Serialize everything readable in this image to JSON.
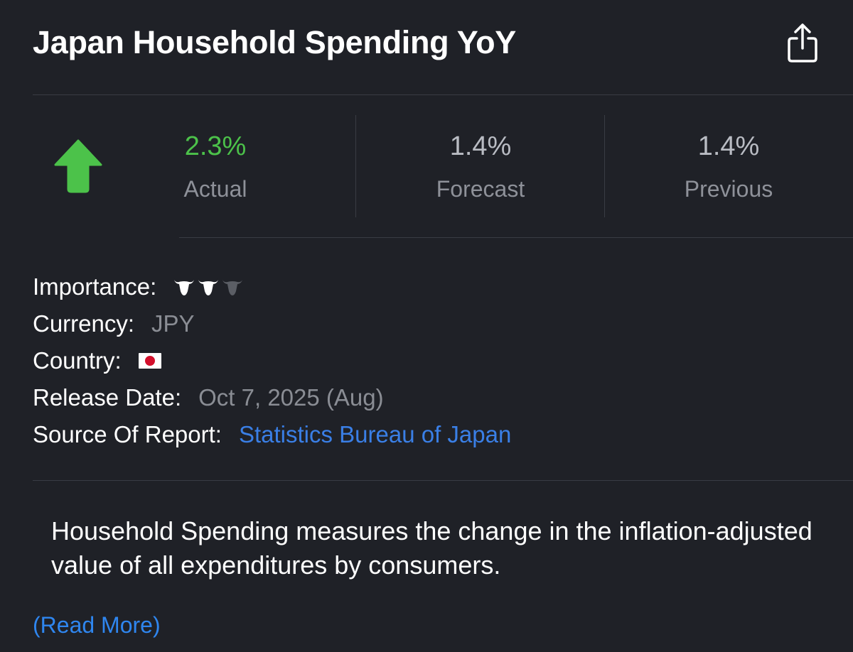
{
  "header": {
    "title": "Japan Household Spending YoY",
    "share_icon": "share-icon"
  },
  "metrics": {
    "direction_icon": "arrow-up-icon",
    "actual": {
      "value": "2.3%",
      "label": "Actual"
    },
    "forecast": {
      "value": "1.4%",
      "label": "Forecast"
    },
    "previous": {
      "value": "1.4%",
      "label": "Previous"
    }
  },
  "info": {
    "importance_label": "Importance:",
    "importance_level": 2,
    "importance_max": 3,
    "importance_icon": "bull-icon",
    "currency_label": "Currency:",
    "currency_value": "JPY",
    "country_label": "Country:",
    "country_flag": "japan-flag-icon",
    "release_label": "Release Date:",
    "release_value": "Oct 7, 2025 (Aug)",
    "source_label": "Source Of Report:",
    "source_value": "Statistics Bureau of Japan"
  },
  "description": {
    "text": "Household Spending measures the change in the inflation-adjusted value of all expenditures by consumers.",
    "read_more": "(Read More)"
  },
  "colors": {
    "background": "#1f2127",
    "positive": "#4cc24a",
    "link": "#3a7fe6",
    "read_more": "#2f86ef"
  }
}
